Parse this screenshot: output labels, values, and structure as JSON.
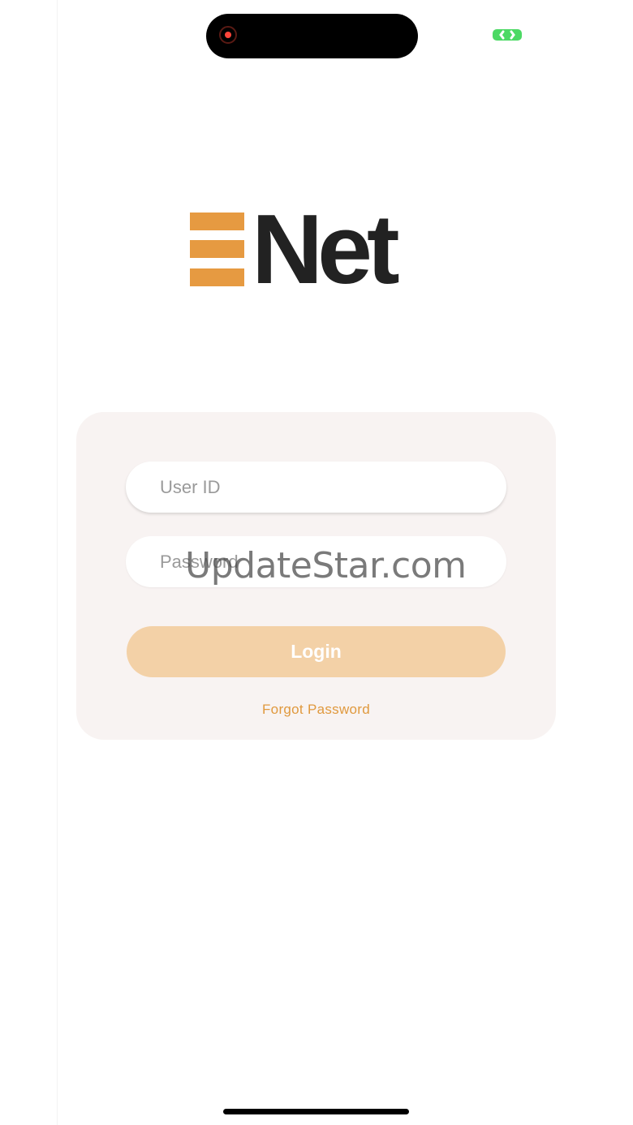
{
  "status_bar": {
    "record_indicator_icon": "screen-record-icon",
    "connection_icon": "link-icon",
    "connection_color": "#4cd964"
  },
  "logo": {
    "wordmark": "Net",
    "mark_color": "#e69a41",
    "wordmark_color": "#222222"
  },
  "login_form": {
    "user_id": {
      "value": "",
      "placeholder": "User ID"
    },
    "password": {
      "value": "",
      "placeholder": "Password"
    },
    "login_label": "Login",
    "forgot_label": "Forgot Password",
    "accent_color": "#e0993e",
    "button_color": "#f3d1a7"
  },
  "watermark": "UpdateStar.com"
}
